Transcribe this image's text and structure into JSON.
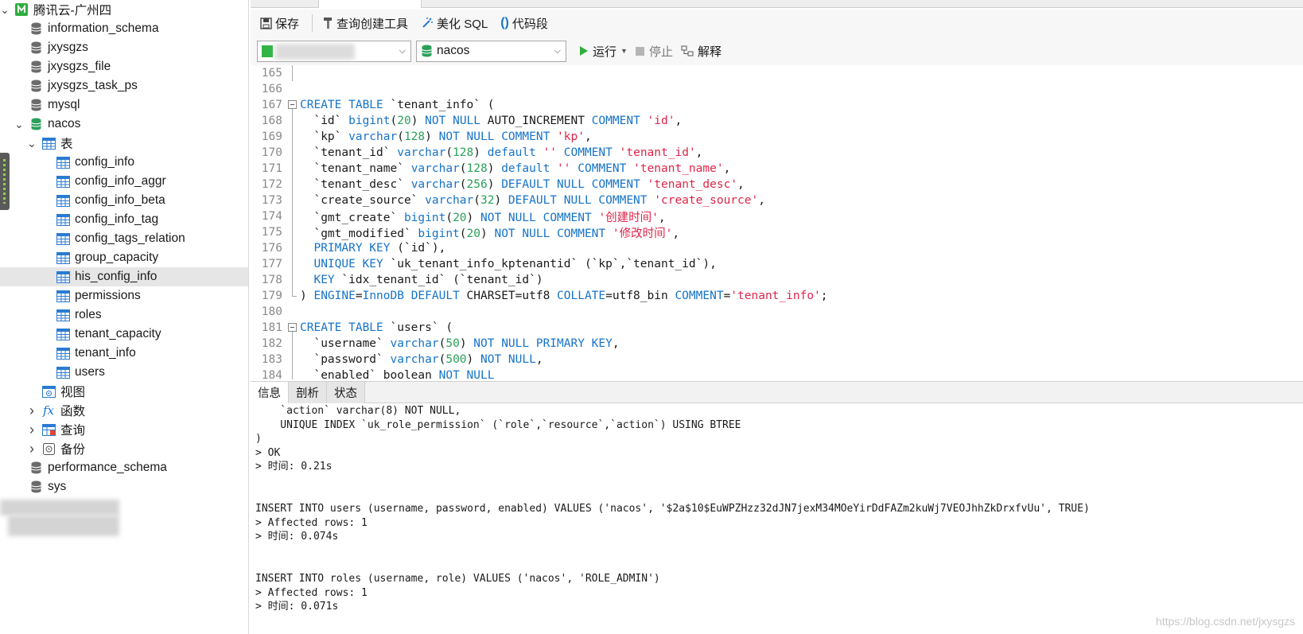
{
  "sidebar": {
    "connection": "腾讯云-广州四",
    "databases_before": [
      "information_schema",
      "jxysgzs",
      "jxysgzs_file",
      "jxysgzs_task_ps",
      "mysql"
    ],
    "open_db": "nacos",
    "tables_group": "表",
    "tables": [
      "config_info",
      "config_info_aggr",
      "config_info_beta",
      "config_info_tag",
      "config_tags_relation",
      "group_capacity",
      "his_config_info",
      "permissions",
      "roles",
      "tenant_capacity",
      "tenant_info",
      "users"
    ],
    "selected_table": "his_config_info",
    "other_groups": [
      "视图",
      "函数",
      "查询",
      "备份"
    ],
    "databases_after": [
      "performance_schema",
      "sys"
    ]
  },
  "toolbar": {
    "save": "保存",
    "query_builder": "查询创建工具",
    "beautify": "美化 SQL",
    "snippet": "代码段"
  },
  "selectors": {
    "database": "nacos",
    "run": "运行",
    "stop": "停止",
    "explain": "解释"
  },
  "editor": {
    "lines": [
      {
        "n": "165",
        "fold": "line",
        "tokens": []
      },
      {
        "n": "166",
        "fold": "none",
        "tokens": []
      },
      {
        "n": "167",
        "fold": "box",
        "tokens": [
          [
            "kw",
            "CREATE TABLE"
          ],
          [
            "plain",
            " `tenant_info` ("
          ]
        ]
      },
      {
        "n": "168",
        "fold": "line",
        "tokens": [
          [
            "plain",
            "  `id` "
          ],
          [
            "kw",
            "bigint"
          ],
          [
            "plain",
            "("
          ],
          [
            "num",
            "20"
          ],
          [
            "plain",
            ") "
          ],
          [
            "kw",
            "NOT NULL"
          ],
          [
            "plain",
            " AUTO_INCREMENT "
          ],
          [
            "kw",
            "COMMENT"
          ],
          [
            "plain",
            " "
          ],
          [
            "str",
            "'id'"
          ],
          [
            "plain",
            ","
          ]
        ]
      },
      {
        "n": "169",
        "fold": "line",
        "tokens": [
          [
            "plain",
            "  `kp` "
          ],
          [
            "kw",
            "varchar"
          ],
          [
            "plain",
            "("
          ],
          [
            "num",
            "128"
          ],
          [
            "plain",
            ") "
          ],
          [
            "kw",
            "NOT NULL COMMENT"
          ],
          [
            "plain",
            " "
          ],
          [
            "str",
            "'kp'"
          ],
          [
            "plain",
            ","
          ]
        ]
      },
      {
        "n": "170",
        "fold": "line",
        "tokens": [
          [
            "plain",
            "  `tenant_id` "
          ],
          [
            "kw",
            "varchar"
          ],
          [
            "plain",
            "("
          ],
          [
            "num",
            "128"
          ],
          [
            "plain",
            ") "
          ],
          [
            "kw",
            "default"
          ],
          [
            "plain",
            " "
          ],
          [
            "str",
            "''"
          ],
          [
            "plain",
            " "
          ],
          [
            "kw",
            "COMMENT"
          ],
          [
            "plain",
            " "
          ],
          [
            "str",
            "'tenant_id'"
          ],
          [
            "plain",
            ","
          ]
        ]
      },
      {
        "n": "171",
        "fold": "line",
        "tokens": [
          [
            "plain",
            "  `tenant_name` "
          ],
          [
            "kw",
            "varchar"
          ],
          [
            "plain",
            "("
          ],
          [
            "num",
            "128"
          ],
          [
            "plain",
            ") "
          ],
          [
            "kw",
            "default"
          ],
          [
            "plain",
            " "
          ],
          [
            "str",
            "''"
          ],
          [
            "plain",
            " "
          ],
          [
            "kw",
            "COMMENT"
          ],
          [
            "plain",
            " "
          ],
          [
            "str",
            "'tenant_name'"
          ],
          [
            "plain",
            ","
          ]
        ]
      },
      {
        "n": "172",
        "fold": "line",
        "tokens": [
          [
            "plain",
            "  `tenant_desc` "
          ],
          [
            "kw",
            "varchar"
          ],
          [
            "plain",
            "("
          ],
          [
            "num",
            "256"
          ],
          [
            "plain",
            ") "
          ],
          [
            "kw",
            "DEFAULT NULL COMMENT"
          ],
          [
            "plain",
            " "
          ],
          [
            "str",
            "'tenant_desc'"
          ],
          [
            "plain",
            ","
          ]
        ]
      },
      {
        "n": "173",
        "fold": "line",
        "tokens": [
          [
            "plain",
            "  `create_source` "
          ],
          [
            "kw",
            "varchar"
          ],
          [
            "plain",
            "("
          ],
          [
            "num",
            "32"
          ],
          [
            "plain",
            ") "
          ],
          [
            "kw",
            "DEFAULT NULL COMMENT"
          ],
          [
            "plain",
            " "
          ],
          [
            "str",
            "'create_source'"
          ],
          [
            "plain",
            ","
          ]
        ]
      },
      {
        "n": "174",
        "fold": "line",
        "tokens": [
          [
            "plain",
            "  `gmt_create` "
          ],
          [
            "kw",
            "bigint"
          ],
          [
            "plain",
            "("
          ],
          [
            "num",
            "20"
          ],
          [
            "plain",
            ") "
          ],
          [
            "kw",
            "NOT NULL COMMENT"
          ],
          [
            "plain",
            " "
          ],
          [
            "str",
            "'创建时间'"
          ],
          [
            "plain",
            ","
          ]
        ]
      },
      {
        "n": "175",
        "fold": "line",
        "tokens": [
          [
            "plain",
            "  `gmt_modified` "
          ],
          [
            "kw",
            "bigint"
          ],
          [
            "plain",
            "("
          ],
          [
            "num",
            "20"
          ],
          [
            "plain",
            ") "
          ],
          [
            "kw",
            "NOT NULL COMMENT"
          ],
          [
            "plain",
            " "
          ],
          [
            "str",
            "'修改时间'"
          ],
          [
            "plain",
            ","
          ]
        ]
      },
      {
        "n": "176",
        "fold": "line",
        "tokens": [
          [
            "plain",
            "  "
          ],
          [
            "kw",
            "PRIMARY KEY"
          ],
          [
            "plain",
            " (`id`),"
          ]
        ]
      },
      {
        "n": "177",
        "fold": "line",
        "tokens": [
          [
            "plain",
            "  "
          ],
          [
            "kw",
            "UNIQUE KEY"
          ],
          [
            "plain",
            " `uk_tenant_info_kptenantid` (`kp`,`tenant_id`),"
          ]
        ]
      },
      {
        "n": "178",
        "fold": "line",
        "tokens": [
          [
            "plain",
            "  "
          ],
          [
            "kw",
            "KEY"
          ],
          [
            "plain",
            " `idx_tenant_id` (`tenant_id`)"
          ]
        ]
      },
      {
        "n": "179",
        "fold": "end",
        "tokens": [
          [
            "plain",
            ") "
          ],
          [
            "kw",
            "ENGINE"
          ],
          [
            "plain",
            "="
          ],
          [
            "kw",
            "InnoDB DEFAULT"
          ],
          [
            "plain",
            " CHARSET=utf8 "
          ],
          [
            "kw",
            "COLLATE"
          ],
          [
            "plain",
            "=utf8_bin "
          ],
          [
            "kw",
            "COMMENT"
          ],
          [
            "plain",
            "="
          ],
          [
            "str",
            "'tenant_info'"
          ],
          [
            "plain",
            ";"
          ]
        ]
      },
      {
        "n": "180",
        "fold": "none",
        "tokens": []
      },
      {
        "n": "181",
        "fold": "box",
        "tokens": [
          [
            "kw",
            "CREATE TABLE"
          ],
          [
            "plain",
            " `users` ("
          ]
        ]
      },
      {
        "n": "182",
        "fold": "line",
        "tokens": [
          [
            "plain",
            "  `username` "
          ],
          [
            "kw",
            "varchar"
          ],
          [
            "plain",
            "("
          ],
          [
            "num",
            "50"
          ],
          [
            "plain",
            ") "
          ],
          [
            "kw",
            "NOT NULL PRIMARY KEY"
          ],
          [
            "plain",
            ","
          ]
        ]
      },
      {
        "n": "183",
        "fold": "line",
        "tokens": [
          [
            "plain",
            "  `password` "
          ],
          [
            "kw",
            "varchar"
          ],
          [
            "plain",
            "("
          ],
          [
            "num",
            "500"
          ],
          [
            "plain",
            ") "
          ],
          [
            "kw",
            "NOT NULL"
          ],
          [
            "plain",
            ","
          ]
        ]
      },
      {
        "n": "184",
        "fold": "line",
        "tokens": [
          [
            "plain",
            "  `enabled` boolean "
          ],
          [
            "kw",
            "NOT NULL"
          ]
        ]
      }
    ]
  },
  "result": {
    "tabs": [
      "信息",
      "剖析",
      "状态"
    ],
    "active_tab": "信息",
    "lines": [
      "    `action` varchar(8) NOT NULL,",
      "    UNIQUE INDEX `uk_role_permission` (`role`,`resource`,`action`) USING BTREE",
      ")",
      "> OK",
      "> 时间: 0.21s",
      "",
      "",
      "INSERT INTO users (username, password, enabled) VALUES ('nacos', '$2a$10$EuWPZHzz32dJN7jexM34MOeYirDdFAZm2kuWj7VEOJhhZkDrxfvUu', TRUE)",
      "> Affected rows: 1",
      "> 时间: 0.074s",
      "",
      "",
      "INSERT INTO roles (username, role) VALUES ('nacos', 'ROLE_ADMIN')",
      "> Affected rows: 1",
      "> 时间: 0.071s"
    ]
  },
  "watermark": "https://blog.csdn.net/jxysgzs",
  "colors": {
    "keyword": "#1673c9",
    "string": "#e0244a",
    "number": "#2aa15a",
    "selected_row": "#e6e6e6",
    "db_open": "#2aa15a"
  }
}
